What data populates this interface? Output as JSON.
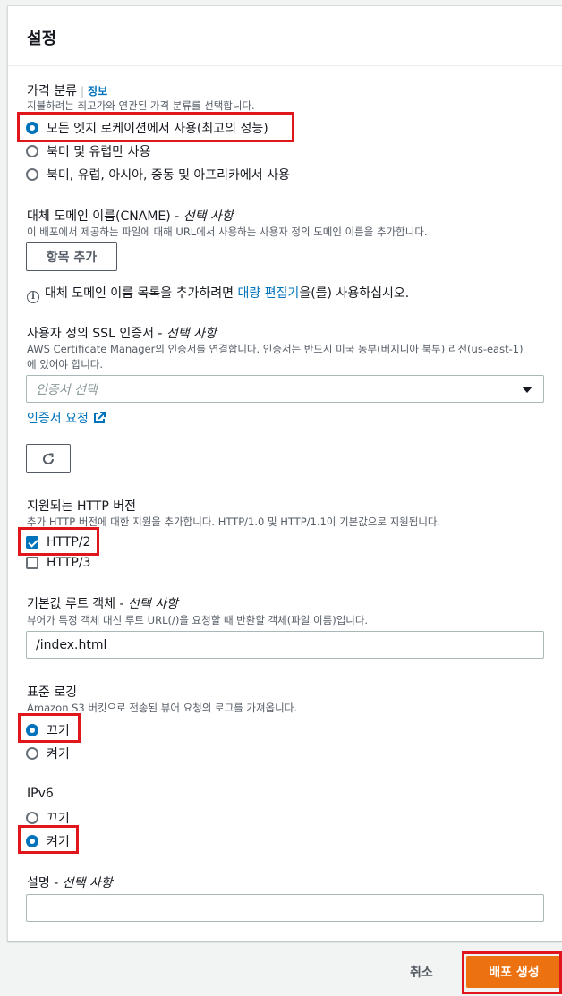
{
  "panel": {
    "title": "설정"
  },
  "price_class": {
    "label": "가격 분류",
    "info": "정보",
    "description": "지불하려는 최고가와 연관된 가격 분류를 선택합니다.",
    "options": [
      {
        "label": "모든 엣지 로케이션에서 사용(최고의 성능)",
        "selected": true
      },
      {
        "label": "북미 및 유럽만 사용",
        "selected": false
      },
      {
        "label": "북미, 유럽, 아시아, 중동 및 아프리카에서 사용",
        "selected": false
      }
    ]
  },
  "cname": {
    "label": "대체 도메인 이름(CNAME)",
    "optional": "선택 사항",
    "description": "이 배포에서 제공하는 파일에 대해 URL에서 사용하는 사용자 정의 도메인 이름을 추가합니다.",
    "add_button": "항목 추가",
    "note_prefix": "대체 도메인 이름 목록을 추가하려면 ",
    "note_link": "대량 편집기",
    "note_suffix": "을(를) 사용하십시오."
  },
  "ssl": {
    "label": "사용자 정의 SSL 인증서",
    "optional": "선택 사항",
    "description_line1": "AWS Certificate Manager의 인증서를 연결합니다. 인증서는 반드시 미국 동부(버지니아 북부) 리전(us-east-1)",
    "description_line2": "에 있어야 합니다.",
    "select_placeholder": "인증서 선택",
    "request_link": "인증서 요청"
  },
  "http": {
    "label": "지원되는 HTTP 버전",
    "description": "추가 HTTP 버전에 대한 지원을 추가합니다. HTTP/1.0 및 HTTP/1.1이 기본값으로 지원됩니다.",
    "options": [
      {
        "label": "HTTP/2",
        "checked": true
      },
      {
        "label": "HTTP/3",
        "checked": false
      }
    ]
  },
  "root_object": {
    "label": "기본값 루트 객체",
    "optional": "선택 사항",
    "description": "뷰어가 특정 객체 대신 루트 URL(/)을 요청할 때 반환할 객체(파일 이름)입니다.",
    "value": "/index.html"
  },
  "logging": {
    "label": "표준 로깅",
    "description": "Amazon S3 버킷으로 전송된 뷰어 요청의 로그를 가져옵니다.",
    "options": [
      {
        "label": "끄기",
        "selected": true
      },
      {
        "label": "켜기",
        "selected": false
      }
    ]
  },
  "ipv6": {
    "label": "IPv6",
    "options": [
      {
        "label": "끄기",
        "selected": false
      },
      {
        "label": "켜기",
        "selected": true
      }
    ]
  },
  "description_field": {
    "label": "설명",
    "optional": "선택 사항",
    "value": ""
  },
  "footer": {
    "cancel": "취소",
    "create": "배포 생성"
  },
  "colors": {
    "accent": "#0073bb",
    "primary_button": "#ec7211",
    "highlight": "#e0161d"
  }
}
